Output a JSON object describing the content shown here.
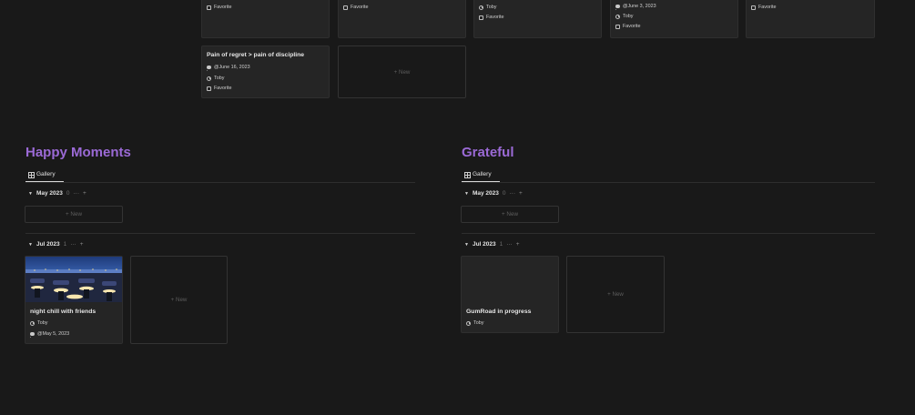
{
  "top_cards": {
    "row1": [
      {
        "props": [
          "favorite"
        ],
        "favorite": "Favorite"
      },
      {
        "props": [
          "favorite"
        ],
        "favorite": "Favorite"
      },
      {
        "person": "Toby",
        "favorite": "Favorite"
      },
      {
        "date": "@June 3, 2023",
        "person": "Toby",
        "favorite": "Favorite"
      },
      {
        "favorite": "Favorite"
      }
    ],
    "row2_card": {
      "title": "Pain of regret > pain of discipline",
      "date": "@June 16, 2023",
      "person": "Toby",
      "favorite": "Favorite"
    },
    "new_label": "+ New"
  },
  "happy": {
    "title": "Happy Moments",
    "tab": "Gallery",
    "groups": [
      {
        "label": "May 2023",
        "count": "0",
        "more": "···",
        "plus": "+",
        "new": "+ New"
      },
      {
        "label": "Jul 2023",
        "count": "1",
        "more": "···",
        "plus": "+"
      }
    ],
    "card": {
      "title": "night chill with friends",
      "person": "Toby",
      "date": "@May 5, 2023"
    },
    "new_label": "+ New"
  },
  "grateful": {
    "title": "Grateful",
    "tab": "Gallery",
    "groups": [
      {
        "label": "May 2023",
        "count": "0",
        "more": "···",
        "plus": "+",
        "new": "+ New"
      },
      {
        "label": "Jul 2023",
        "count": "1",
        "more": "···",
        "plus": "+"
      }
    ],
    "card": {
      "title": "GumRoad in progress",
      "person": "Toby"
    },
    "new_label": "+ New"
  },
  "colors": {
    "accent": "#9b6ad6",
    "background": "#191919",
    "card": "#252525"
  }
}
